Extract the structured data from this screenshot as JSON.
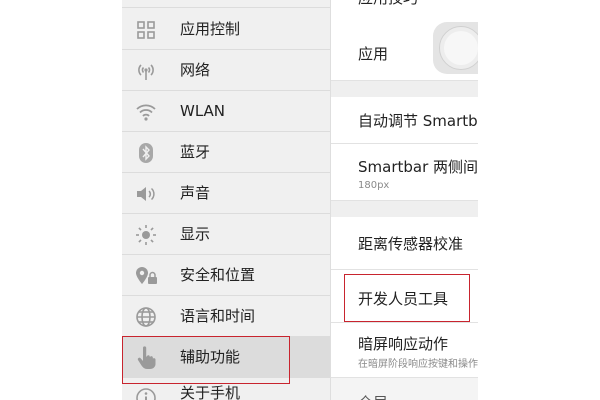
{
  "sidebar": {
    "items": [
      {
        "label": "应用控制",
        "icon": "apps-grid-icon"
      },
      {
        "label": "网络",
        "icon": "antenna-icon"
      },
      {
        "label": "WLAN",
        "icon": "wifi-icon"
      },
      {
        "label": "蓝牙",
        "icon": "bluetooth-icon"
      },
      {
        "label": "声音",
        "icon": "speaker-icon"
      },
      {
        "label": "显示",
        "icon": "brightness-icon"
      },
      {
        "label": "安全和位置",
        "icon": "lock-location-icon"
      },
      {
        "label": "语言和时间",
        "icon": "globe-icon"
      },
      {
        "label": "辅助功能",
        "icon": "hand-pointer-icon"
      },
      {
        "label": "关于手机",
        "icon": "info-icon"
      }
    ],
    "selected": "辅助功能"
  },
  "detail": {
    "top_partial": "应用技巧",
    "app_row": {
      "title": "应用"
    },
    "smartbar_auto": {
      "title": "自动调节 Smartbar"
    },
    "smartbar_spacing": {
      "title": "Smartbar 两侧间距",
      "value": "180px"
    },
    "proximity": {
      "title": "距离传感器校准"
    },
    "developer": {
      "title": "开发人员工具"
    },
    "dark_screen": {
      "title": "暗屏响应动作",
      "subtitle": "在暗屏阶段响应按键和操作"
    },
    "bottom_partial": "全局"
  },
  "colors": {
    "highlight": "#c8242e",
    "sidebar_bg": "#f0f0f0",
    "selected_bg": "#dcdcdc"
  }
}
